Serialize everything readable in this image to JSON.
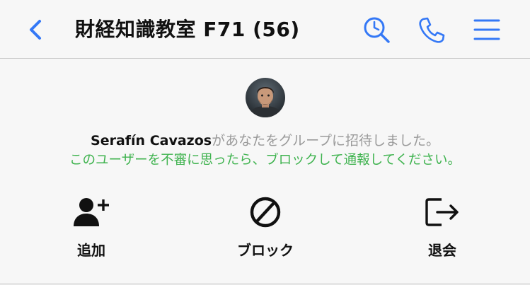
{
  "header": {
    "title": "財経知識教室 F71 (56)",
    "accent_color": "#3478f6",
    "icons": [
      "back-chevron-icon",
      "search-clock-icon",
      "phone-icon",
      "menu-icon"
    ]
  },
  "invite": {
    "inviter_name": "Serafín Cavazos",
    "message": "があなたをグループに招待しました。",
    "warning": "このユーザーを不審に思ったら、ブロックして通報してください。",
    "warning_color": "#3fb34f"
  },
  "actions": [
    {
      "label": "追加",
      "icon": "add-user-icon"
    },
    {
      "label": "ブロック",
      "icon": "block-icon"
    },
    {
      "label": "退会",
      "icon": "leave-icon"
    }
  ]
}
